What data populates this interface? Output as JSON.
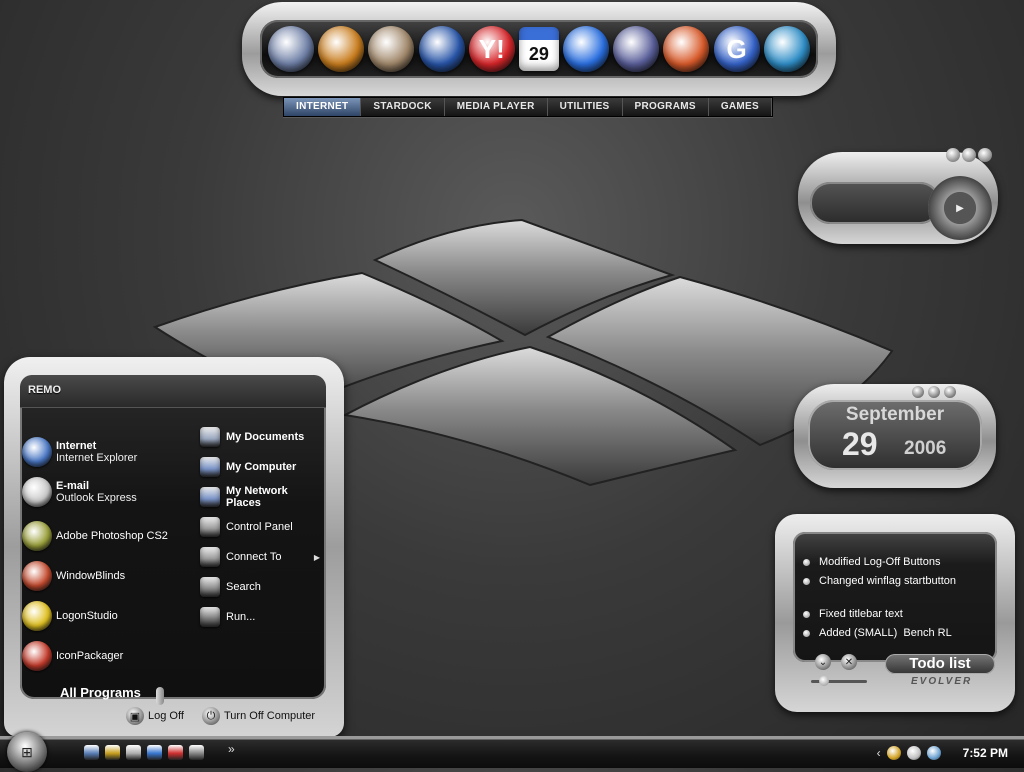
{
  "dock": {
    "icons": [
      {
        "name": "monitor-icon",
        "glyph": "",
        "bg": "#6e7fa6"
      },
      {
        "name": "orbit-browser-icon",
        "glyph": "",
        "bg": "#c97d1e"
      },
      {
        "name": "media-headphones-icon",
        "glyph": "",
        "bg": "#a0876a"
      },
      {
        "name": "thunderbird-icon",
        "glyph": "",
        "bg": "#2855a8"
      },
      {
        "name": "yahoo-messenger-icon",
        "glyph": "Y!",
        "bg": "#d7262a"
      },
      {
        "name": "calendar-icon",
        "glyph": "29",
        "bg": "#ffffff"
      },
      {
        "name": "msn-buddy-icon",
        "glyph": "",
        "bg": "#2a6fe0"
      },
      {
        "name": "magnifier-search-icon",
        "glyph": "",
        "bg": "#5a5f9a"
      },
      {
        "name": "msn-butterfly-icon",
        "glyph": "",
        "bg": "#d85a2a"
      },
      {
        "name": "google-icon",
        "glyph": "G",
        "bg": "#3563c9"
      },
      {
        "name": "tools-icon",
        "glyph": "",
        "bg": "#2f8ec7"
      }
    ]
  },
  "tabs": [
    "INTERNET",
    "STARDOCK",
    "MEDIA PLAYER",
    "UTILITIES",
    "PROGRAMS",
    "GAMES"
  ],
  "start_menu": {
    "user": "REMO",
    "left": [
      {
        "title": "Internet",
        "sub": "Internet Explorer",
        "color": "#4a78c6"
      },
      {
        "title": "E-mail",
        "sub": "Outlook Express",
        "color": "#c9c9c9"
      },
      {
        "title": "Adobe Photoshop CS2",
        "sub": "",
        "color": "#9aa03a"
      },
      {
        "title": "WindowBlinds",
        "sub": "",
        "color": "#c44a2e"
      },
      {
        "title": "LogonStudio",
        "sub": "",
        "color": "#e0c020"
      },
      {
        "title": "IconPackager",
        "sub": "",
        "color": "#c43a2a"
      }
    ],
    "right": [
      {
        "label": "My Documents",
        "bold": true,
        "color": "#9aa8c0"
      },
      {
        "label": "My Computer",
        "bold": true,
        "color": "#7a94c8"
      },
      {
        "label": "My Network Places",
        "bold": true,
        "color": "#7a94c8"
      },
      {
        "label": "Control Panel",
        "bold": false,
        "color": "#9a9a9a"
      },
      {
        "label": "Connect To",
        "bold": false,
        "color": "#9a9a9a"
      },
      {
        "label": "Search",
        "bold": false,
        "color": "#888888"
      },
      {
        "label": "Run...",
        "bold": false,
        "color": "#777777"
      }
    ],
    "all_programs": "All Programs",
    "log_off": "Log Off",
    "turn_off": "Turn Off Computer"
  },
  "calendar": {
    "month": "September",
    "day": "29",
    "year": "2006"
  },
  "todo": {
    "items": [
      "Modified Log-Off Buttons",
      "Changed winflag startbutton",
      "Fixed titlebar text",
      "Added (SMALL)  Bench RL"
    ],
    "label": "Todo list",
    "brand": "EVOLVER"
  },
  "taskbar": {
    "quick_launch_colors": [
      "#5a7fb8",
      "#c8a020",
      "#b0b0b0",
      "#3a78d0",
      "#d03030",
      "#888888"
    ],
    "more": "»",
    "tray_colors": [
      "#d0a020",
      "#c0c0c0",
      "#6aa0d0"
    ],
    "clock": "7:52 PM"
  }
}
